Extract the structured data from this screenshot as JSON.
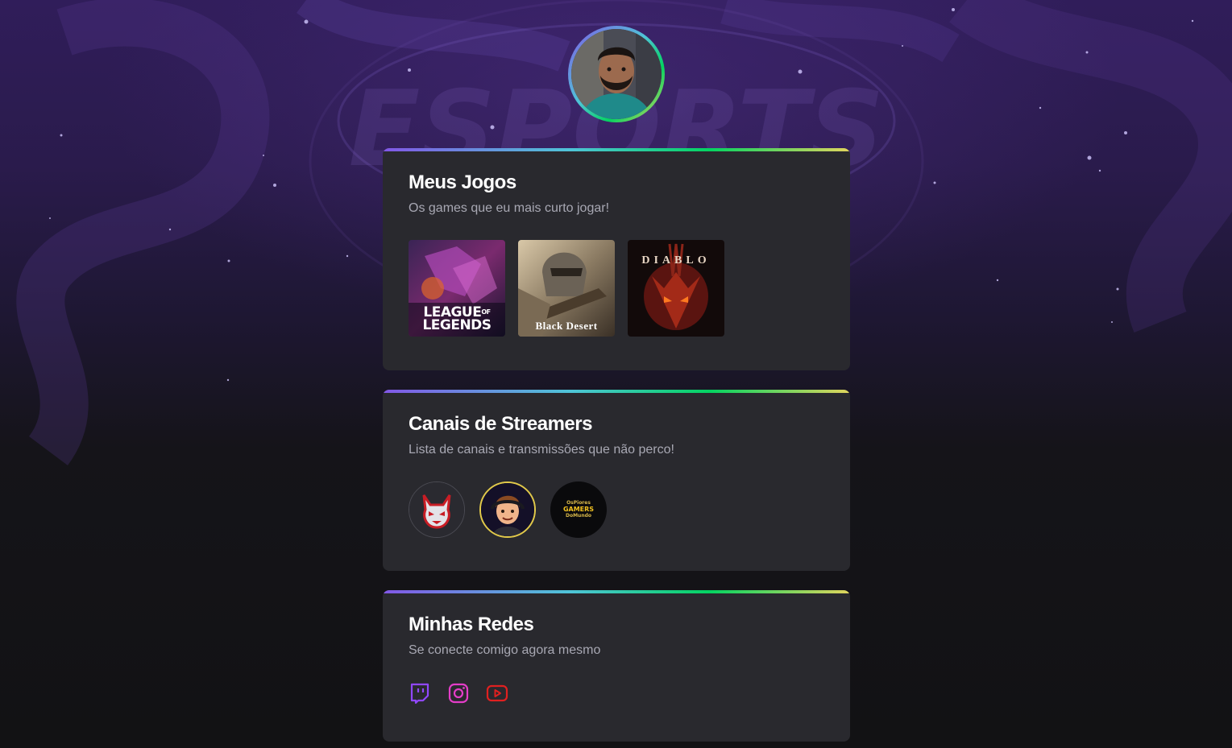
{
  "profile": {
    "avatar_alt": "avatar"
  },
  "background": {
    "watermark_text": "ESPORTS"
  },
  "colors": {
    "gradient": [
      "#8257e6",
      "#4fc4d8",
      "#04d361",
      "#e1d55d"
    ],
    "card_bg": "#29292e",
    "page_bg": "#121214",
    "title": "#ffffff",
    "subtitle": "#a8a8b3",
    "twitch": "#9147ff",
    "instagram": "#e43dc8",
    "youtube": "#e02020"
  },
  "games_card": {
    "title": "Meus Jogos",
    "subtitle": "Os games que eu mais curto jogar!",
    "games": [
      {
        "label_line1": "LEAGUE",
        "label_of": "OF",
        "label_line2": "LEGENDS"
      },
      {
        "label": "Black Desert"
      },
      {
        "label": "DIABLO"
      }
    ]
  },
  "streamers_card": {
    "title": "Canais de Streamers",
    "subtitle": "Lista de canais e transmissões que não perco!",
    "streamers": [
      {
        "icon": "demon-mascot-icon"
      },
      {
        "icon": "cartoon-face-icon"
      },
      {
        "line1": "OsPiores",
        "line2": "GAMERS",
        "line3": "DoMundo"
      }
    ]
  },
  "social_card": {
    "title": "Minhas Redes",
    "subtitle": "Se conecte comigo agora mesmo",
    "links": [
      {
        "icon": "twitch-icon"
      },
      {
        "icon": "instagram-icon"
      },
      {
        "icon": "youtube-icon"
      }
    ]
  }
}
